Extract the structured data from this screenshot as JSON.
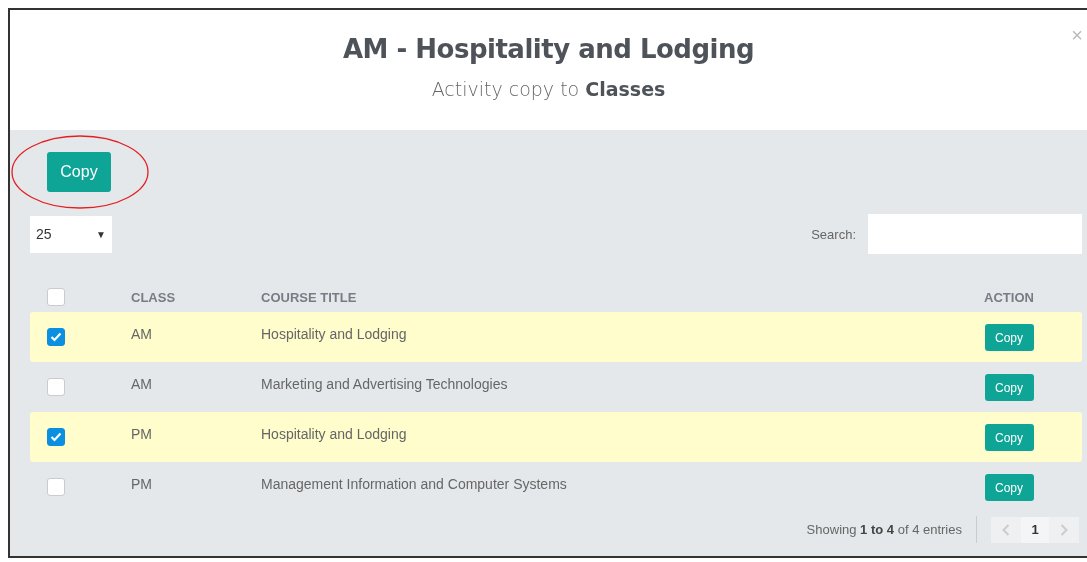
{
  "modal": {
    "title": "AM - Hospitality and Lodging",
    "subtitle": "Activity copy to **Classes**",
    "close": "×"
  },
  "toolbar": {
    "copy_button": "Copy"
  },
  "page_size": {
    "value": "25",
    "caret": "▼"
  },
  "search": {
    "label": "Search:"
  },
  "table": {
    "columns": [
      "CLASS",
      "COURSE TITLE",
      "ACTION"
    ],
    "select_all": {
      "checked": false
    },
    "rows": [
      {
        "checked": true,
        "class": "AM",
        "course_title": "Hospitality and Lodging",
        "action": "Copy"
      },
      {
        "checked": false,
        "class": "AM",
        "course_title": "Marketing and Advertising Technologies",
        "action": "Copy"
      },
      {
        "checked": true,
        "class": "PM",
        "course_title": "Hospitality and Lodging",
        "action": "Copy"
      },
      {
        "checked": false,
        "class": "PM",
        "course_title": "Management Information and Computer Systems",
        "action": "Copy"
      }
    ]
  },
  "footer": {
    "info": "Showing **1 to 4** of 4 entries",
    "pages": [
      {
        "label": "1",
        "selected": true
      }
    ]
  }
}
